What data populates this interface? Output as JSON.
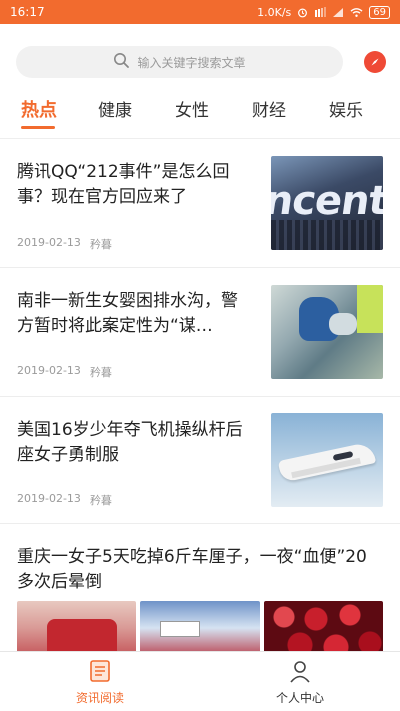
{
  "status_bar": {
    "time": "16:17",
    "network_speed": "1.0K/s",
    "battery": "69",
    "icons": [
      "alarm-icon",
      "sim-icon",
      "signal-icon",
      "wifi-icon",
      "battery-icon"
    ]
  },
  "search": {
    "placeholder": "输入关键字搜索文章",
    "icon": "search-icon",
    "action_icon": "compass-icon"
  },
  "tabs": [
    {
      "label": "热点",
      "active": true
    },
    {
      "label": "健康",
      "active": false
    },
    {
      "label": "女性",
      "active": false
    },
    {
      "label": "财经",
      "active": false
    },
    {
      "label": "娱乐",
      "active": false
    }
  ],
  "articles": [
    {
      "title": "腾讯QQ“212事件”是怎么回事？现在官方回应来了",
      "date": "2019-02-13",
      "source": "矜暮"
    },
    {
      "title": "南非一新生女婴困排水沟，警方暂时将此案定性为“谋…",
      "date": "2019-02-13",
      "source": "矜暮"
    },
    {
      "title": "美国16岁少年夺飞机操纵杆后座女子勇制服",
      "date": "2019-02-13",
      "source": "矜暮"
    },
    {
      "title": "重庆一女子5天吃掉6斤车厘子，一夜“血便”20多次后晕倒"
    }
  ],
  "bottom_nav": [
    {
      "label": "资讯阅读",
      "icon": "news-icon",
      "active": true
    },
    {
      "label": "个人中心",
      "icon": "user-icon",
      "active": false
    }
  ],
  "colors": {
    "accent": "#f26b2e",
    "compass": "#ef4a36"
  }
}
